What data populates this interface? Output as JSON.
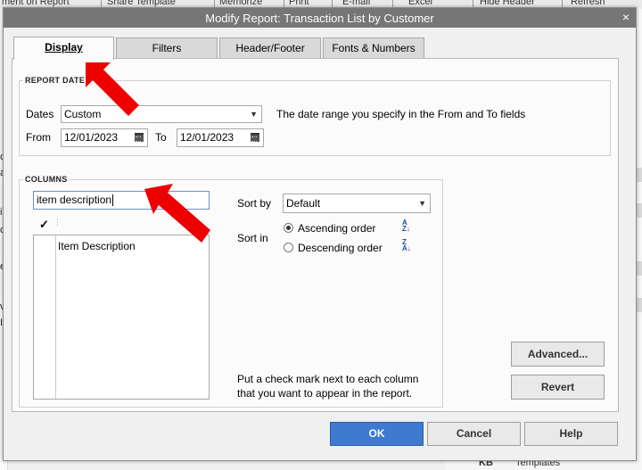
{
  "background": {
    "toolbar_items": [
      "ment on Report",
      "Share Template",
      "Memorize",
      "Print",
      "E-mail",
      "Excel",
      "Hide Header",
      "Refresh"
    ],
    "left_letters": [
      "c",
      "a",
      "i",
      "c",
      "e",
      "v",
      "I"
    ],
    "bottom_code": "KB",
    "bottom_label": "Templates"
  },
  "dialog": {
    "title": "Modify Report: Transaction List by Customer",
    "close_glyph": "×",
    "tabs": [
      {
        "label": "Display",
        "active": true
      },
      {
        "label": "Filters",
        "active": false
      },
      {
        "label": "Header/Footer",
        "active": false
      },
      {
        "label": "Fonts & Numbers",
        "active": false
      }
    ]
  },
  "report_date": {
    "section_title": "REPORT DATE",
    "dates_label": "Dates",
    "dates_value": "Custom",
    "dates_hint": "The date range you specify in the From and To fields",
    "from_label": "From",
    "from_value": "12/01/2023",
    "to_label": "To",
    "to_value": "12/01/2023"
  },
  "columns": {
    "section_title": "COLUMNS",
    "search_value": "item description",
    "check_header": "✓",
    "items": [
      {
        "label": "Item Description",
        "checked": false
      }
    ],
    "sort_by_label": "Sort by",
    "sort_by_value": "Default",
    "sort_in_label": "Sort in",
    "ascending_label": "Ascending order",
    "descending_label": "Descending order",
    "sort_selected": "ascending",
    "note_line1": "Put a check mark next to each column",
    "note_line2": "that you want to appear in the report."
  },
  "buttons": {
    "advanced": "Advanced...",
    "revert": "Revert",
    "ok": "OK",
    "cancel": "Cancel",
    "help": "Help"
  },
  "colors": {
    "titlebar": "#767676",
    "ok_button": "#3f79d0",
    "annotation_arrow": "#ee0000"
  }
}
